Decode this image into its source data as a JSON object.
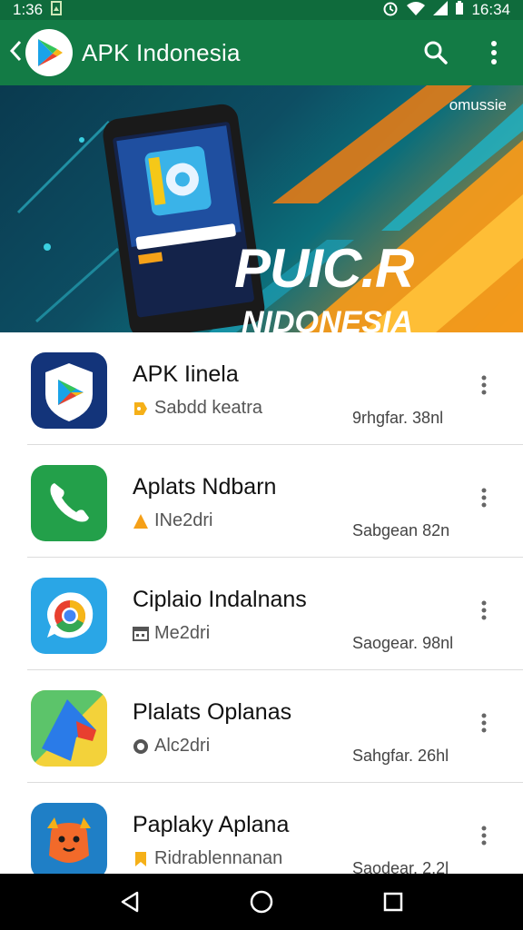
{
  "status_bar": {
    "left_time": "1:36",
    "right_time": "16:34",
    "icons": [
      "image-icon",
      "alarm-icon",
      "wifi-icon",
      "signal-icon",
      "battery-icon"
    ]
  },
  "app_bar": {
    "title": "APK Indonesia",
    "icons": [
      "back-chevron-icon",
      "play-store-logo",
      "search-icon",
      "more-vert-icon"
    ],
    "color": "#137b45"
  },
  "banner": {
    "brand": "omussie",
    "title": "PUIC.R",
    "subtitle": "NIDONESIA"
  },
  "apps": [
    {
      "name": "APK Iinela",
      "subtitle": "Sabdd keatra",
      "meta": "9rhgfar. 38nl",
      "icon": "play-store-icon",
      "sub_icon": "tag-icon"
    },
    {
      "name": "Aplats Ndbarn",
      "subtitle": "INe2dri",
      "meta": "Sabgean 82n",
      "icon": "phone-icon",
      "sub_icon": "warning-icon"
    },
    {
      "name": "Ciplaio Indalnans",
      "subtitle": "Me2dri",
      "meta": "Saogear. 98nl",
      "icon": "chrome-icon",
      "sub_icon": "calendar-icon"
    },
    {
      "name": "Plalats Oplanas",
      "subtitle": "Alc2dri",
      "meta": "Sahgfar. 26hl",
      "icon": "arrow-app-icon",
      "sub_icon": "circle-icon"
    },
    {
      "name": "Paplaky Aplana",
      "subtitle": "Ridrablennanan",
      "meta": "Saodear. 2.2l",
      "icon": "mascot-app-icon",
      "sub_icon": "bookmark-icon"
    }
  ],
  "nav_bar": {
    "buttons": [
      "back-icon",
      "home-icon",
      "recents-icon"
    ]
  }
}
